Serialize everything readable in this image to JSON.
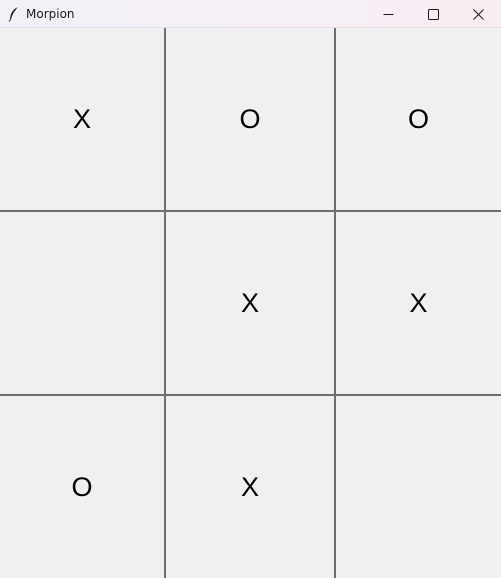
{
  "window": {
    "title": "Morpion",
    "app_icon": "feather-icon",
    "controls": [
      "minimize-icon",
      "maximize-icon",
      "close-icon"
    ]
  },
  "board": {
    "cells": [
      [
        "X",
        "O",
        "O"
      ],
      [
        "",
        "X",
        "X"
      ],
      [
        "O",
        "X",
        ""
      ]
    ]
  }
}
